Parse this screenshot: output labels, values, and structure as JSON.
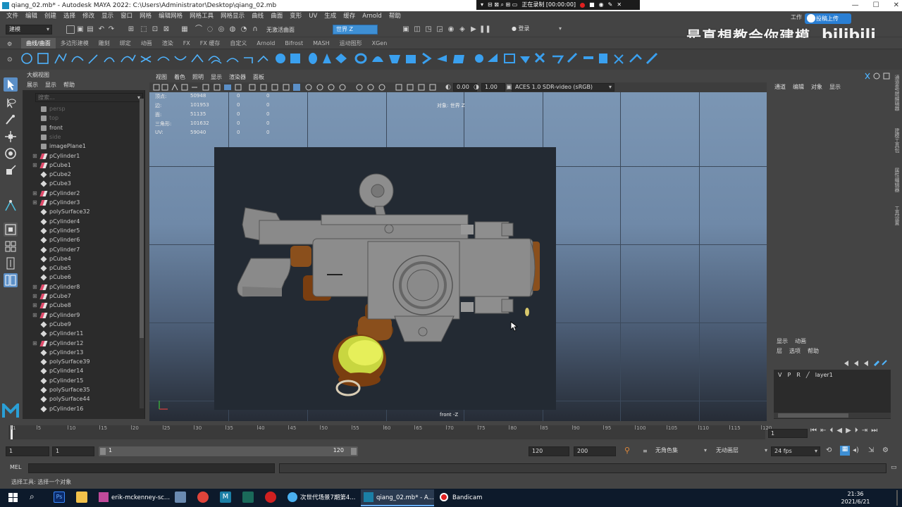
{
  "window": {
    "title": "qiang_02.mb* - Autodesk MAYA 2022: C:\\Users\\Administrator\\Desktop\\qiang_02.mb",
    "recording_status": "正在录制 [00:00:00]",
    "controls": [
      "—",
      "☐",
      "✕"
    ]
  },
  "menubar": [
    "文件",
    "编辑",
    "创建",
    "选择",
    "修改",
    "显示",
    "窗口",
    "网格",
    "编辑网格",
    "网格工具",
    "网格显示",
    "曲线",
    "曲面",
    "变形",
    "UV",
    "生成",
    "缓存",
    "Arnold",
    "帮助"
  ],
  "statusline": {
    "mode_dropdown": "建模",
    "curve_label": "无激活曲面",
    "world_field": "世界 Z",
    "login_dropdown": "登录",
    "workspace_label": "工作",
    "upload_label": "投稿上传"
  },
  "watermark": {
    "text": "是真想教会你建模",
    "logo": "bilibili"
  },
  "shelf_tabs": [
    "曲线/曲面",
    "多边形建模",
    "雕刻",
    "绑定",
    "动画",
    "渲染",
    "FX",
    "FX 缓存",
    "自定义",
    "Arnold",
    "Bifrost",
    "MASH",
    "运动图形",
    "XGen"
  ],
  "shelf_active_tab": 0,
  "outliner": {
    "title": "大纲视图",
    "menu": [
      "展示",
      "显示",
      "帮助"
    ],
    "search_placeholder": "搜索...",
    "items": [
      {
        "name": "persp",
        "type": "camera",
        "dim": true,
        "expand": false
      },
      {
        "name": "top",
        "type": "camera",
        "dim": true,
        "expand": false
      },
      {
        "name": "front",
        "type": "camera",
        "dim": false,
        "expand": false
      },
      {
        "name": "side",
        "type": "camera",
        "dim": true,
        "expand": false
      },
      {
        "name": "imagePlane1",
        "type": "image",
        "dim": false,
        "expand": false
      },
      {
        "name": "pCylinder1",
        "type": "group",
        "dim": false,
        "expand": true
      },
      {
        "name": "pCube1",
        "type": "group",
        "dim": false,
        "expand": true
      },
      {
        "name": "pCube2",
        "type": "mesh",
        "dim": false,
        "expand": false
      },
      {
        "name": "pCube3",
        "type": "mesh",
        "dim": false,
        "expand": false
      },
      {
        "name": "pCylinder2",
        "type": "group",
        "dim": false,
        "expand": true
      },
      {
        "name": "pCylinder3",
        "type": "group",
        "dim": false,
        "expand": true
      },
      {
        "name": "polySurface32",
        "type": "mesh",
        "dim": false,
        "expand": false
      },
      {
        "name": "pCylinder4",
        "type": "mesh",
        "dim": false,
        "expand": false
      },
      {
        "name": "pCylinder5",
        "type": "mesh",
        "dim": false,
        "expand": false
      },
      {
        "name": "pCylinder6",
        "type": "mesh",
        "dim": false,
        "expand": false
      },
      {
        "name": "pCylinder7",
        "type": "mesh",
        "dim": false,
        "expand": false
      },
      {
        "name": "pCube4",
        "type": "mesh",
        "dim": false,
        "expand": false
      },
      {
        "name": "pCube5",
        "type": "mesh",
        "dim": false,
        "expand": false
      },
      {
        "name": "pCube6",
        "type": "mesh",
        "dim": false,
        "expand": false
      },
      {
        "name": "pCylinder8",
        "type": "group",
        "dim": false,
        "expand": true
      },
      {
        "name": "pCube7",
        "type": "group",
        "dim": false,
        "expand": true
      },
      {
        "name": "pCube8",
        "type": "group",
        "dim": false,
        "expand": true
      },
      {
        "name": "pCylinder9",
        "type": "group",
        "dim": false,
        "expand": true
      },
      {
        "name": "pCube9",
        "type": "mesh",
        "dim": false,
        "expand": false
      },
      {
        "name": "pCylinder11",
        "type": "mesh",
        "dim": false,
        "expand": false
      },
      {
        "name": "pCylinder12",
        "type": "group",
        "dim": false,
        "expand": true
      },
      {
        "name": "pCylinder13",
        "type": "mesh",
        "dim": false,
        "expand": false
      },
      {
        "name": "polySurface39",
        "type": "mesh",
        "dim": false,
        "expand": false
      },
      {
        "name": "pCylinder14",
        "type": "mesh",
        "dim": false,
        "expand": false
      },
      {
        "name": "pCylinder15",
        "type": "mesh",
        "dim": false,
        "expand": false
      },
      {
        "name": "polySurface35",
        "type": "mesh",
        "dim": false,
        "expand": false
      },
      {
        "name": "polySurface44",
        "type": "mesh",
        "dim": false,
        "expand": false
      },
      {
        "name": "pCylinder16",
        "type": "mesh",
        "dim": false,
        "expand": false
      }
    ]
  },
  "viewport": {
    "menu": [
      "视图",
      "着色",
      "照明",
      "显示",
      "渲染器",
      "面板"
    ],
    "toolbar": {
      "value_a": "0.00",
      "value_b": "1.00",
      "color_space": "ACES 1.0 SDR-video (sRGB)"
    },
    "hud": [
      {
        "label": "顶点:",
        "total": "50948",
        "sel": "0",
        "comp": "0"
      },
      {
        "label": "边:",
        "total": "101953",
        "sel": "0",
        "comp": "0"
      },
      {
        "label": "面:",
        "total": "51135",
        "sel": "0",
        "comp": "0"
      },
      {
        "label": "三角形:",
        "total": "101632",
        "sel": "0",
        "comp": "0"
      },
      {
        "label": "UV:",
        "total": "59040",
        "sel": "0",
        "comp": "0"
      }
    ],
    "object_label": "对象: 世界 Z",
    "camera_label": "front -Z"
  },
  "channel_box": {
    "menu": [
      "通道",
      "编辑",
      "对象",
      "显示"
    ]
  },
  "layer_editor": {
    "tabs": [
      "显示",
      "动画"
    ],
    "menu": [
      "层",
      "选项",
      "帮助"
    ],
    "layer": {
      "v": "V",
      "p": "P",
      "r": "R",
      "name": "layer1"
    }
  },
  "right_strip": [
    "通道盒/层编辑器",
    "建模工具包",
    "属性编辑器",
    "工具设置"
  ],
  "timeline": {
    "ticks": [
      "1",
      "5",
      "10",
      "15",
      "20",
      "25",
      "30",
      "35",
      "40",
      "45",
      "50",
      "55",
      "60",
      "65",
      "70",
      "75",
      "80",
      "85",
      "90",
      "95",
      "100",
      "105",
      "110",
      "115",
      "120"
    ],
    "current_frame": "1"
  },
  "range": {
    "start": "1",
    "inner_start": "1",
    "bar_start": "1",
    "bar_end": "120",
    "end": "120",
    "max_end": "200",
    "char_set": "无角色集",
    "anim_layer": "无动画层",
    "fps": "24 fps"
  },
  "command": {
    "mel_label": "MEL",
    "help_text": "选择工具: 选择一个对象"
  },
  "taskbar": {
    "items": [
      {
        "label": "erik-mckenney-sc...",
        "active": false
      },
      {
        "label": "次世代场景7期第4...",
        "active": false
      },
      {
        "label": "qiang_02.mb* - A...",
        "active": true
      },
      {
        "label": "Bandicam",
        "active": false
      }
    ],
    "time": "21:36",
    "date": "2021/6/21"
  },
  "colors": {
    "maya_bg": "#444444",
    "panel_dark": "#2b2b2b",
    "viewport_top": "#7b96b4",
    "accent_blue": "#3e8fd4",
    "taskbar": "#0d1a2b",
    "record_red": "#e02020"
  }
}
